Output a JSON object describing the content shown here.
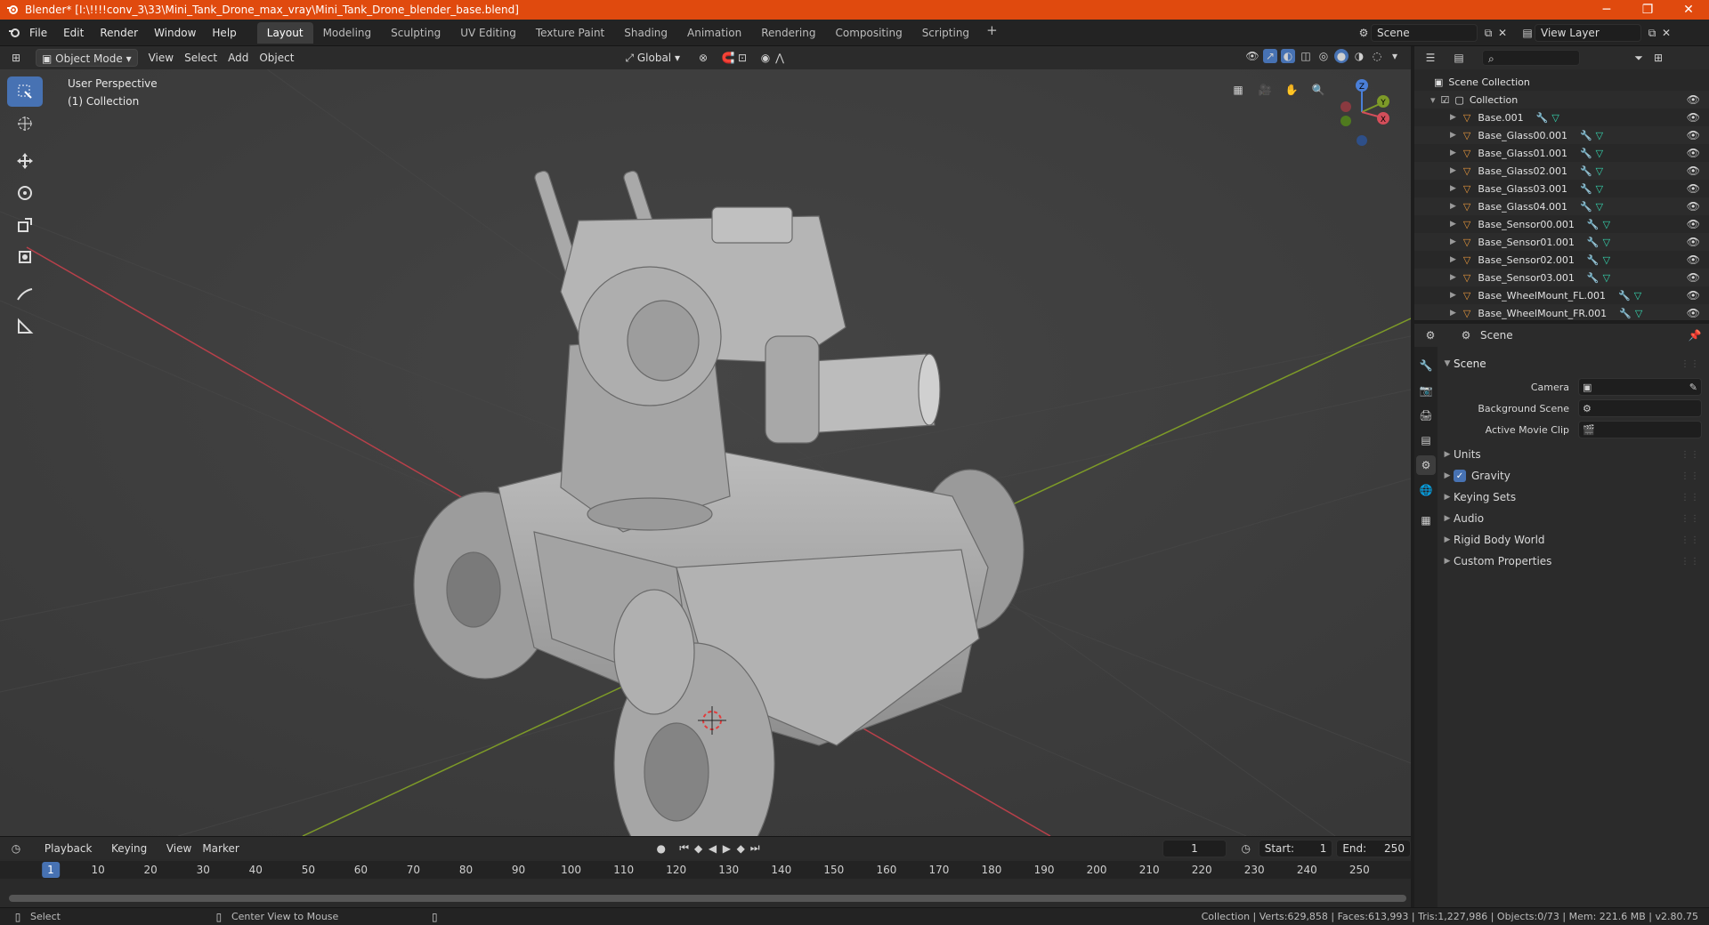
{
  "window": {
    "title": "Blender* [I:\\!!!!conv_3\\33\\Mini_Tank_Drone_max_vray\\Mini_Tank_Drone_blender_base.blend]"
  },
  "menu": {
    "items": [
      "File",
      "Edit",
      "Render",
      "Window",
      "Help"
    ]
  },
  "workspaces": {
    "tabs": [
      "Layout",
      "Modeling",
      "Sculpting",
      "UV Editing",
      "Texture Paint",
      "Shading",
      "Animation",
      "Rendering",
      "Compositing",
      "Scripting"
    ],
    "active": "Layout"
  },
  "top_right": {
    "scene": "Scene",
    "view_layer": "View Layer"
  },
  "viewport_header": {
    "mode": "Object Mode",
    "menus": [
      "View",
      "Select",
      "Add",
      "Object"
    ],
    "orientation": "Global"
  },
  "viewport": {
    "view_name": "User Perspective",
    "collection_label": "(1) Collection",
    "axis_labels": {
      "z": "Z",
      "y": "Y",
      "x": "X"
    },
    "colors": {
      "background": "#3d3d3d",
      "x_axis": "#b8404a",
      "y_axis": "#7d9a28",
      "active_tool": "#4772b3"
    }
  },
  "outliner": {
    "root": "Scene Collection",
    "collection": "Collection",
    "items": [
      "Base.001",
      "Base_Glass00.001",
      "Base_Glass01.001",
      "Base_Glass02.001",
      "Base_Glass03.001",
      "Base_Glass04.001",
      "Base_Sensor00.001",
      "Base_Sensor01.001",
      "Base_Sensor02.001",
      "Base_Sensor03.001",
      "Base_WheelMount_FL.001",
      "Base_WheelMount_FR.001"
    ]
  },
  "properties": {
    "context": "Scene",
    "panel_title": "Scene",
    "rows": [
      {
        "label": "Camera",
        "value": ""
      },
      {
        "label": "Background Scene",
        "value": ""
      },
      {
        "label": "Active Movie Clip",
        "value": ""
      }
    ],
    "sections": [
      "Units",
      "Gravity",
      "Keying Sets",
      "Audio",
      "Rigid Body World",
      "Custom Properties"
    ],
    "gravity_enabled": true
  },
  "timeline": {
    "menus": [
      "Playback",
      "Keying",
      "View",
      "Marker"
    ],
    "current_frame": "1",
    "start_label": "Start:",
    "start": "1",
    "end_label": "End:",
    "end": "250",
    "ticks": [
      "10",
      "20",
      "30",
      "40",
      "50",
      "60",
      "70",
      "80",
      "90",
      "100",
      "110",
      "120",
      "130",
      "140",
      "150",
      "160",
      "170",
      "180",
      "190",
      "200",
      "210",
      "220",
      "230",
      "240",
      "250"
    ]
  },
  "statusbar": {
    "left_action": "Select",
    "middle_action": "Center View to Mouse",
    "stats": "Collection | Verts:629,858 | Faces:613,993 | Tris:1,227,986 | Objects:0/73 | Mem: 221.6 MB | v2.80.75"
  }
}
